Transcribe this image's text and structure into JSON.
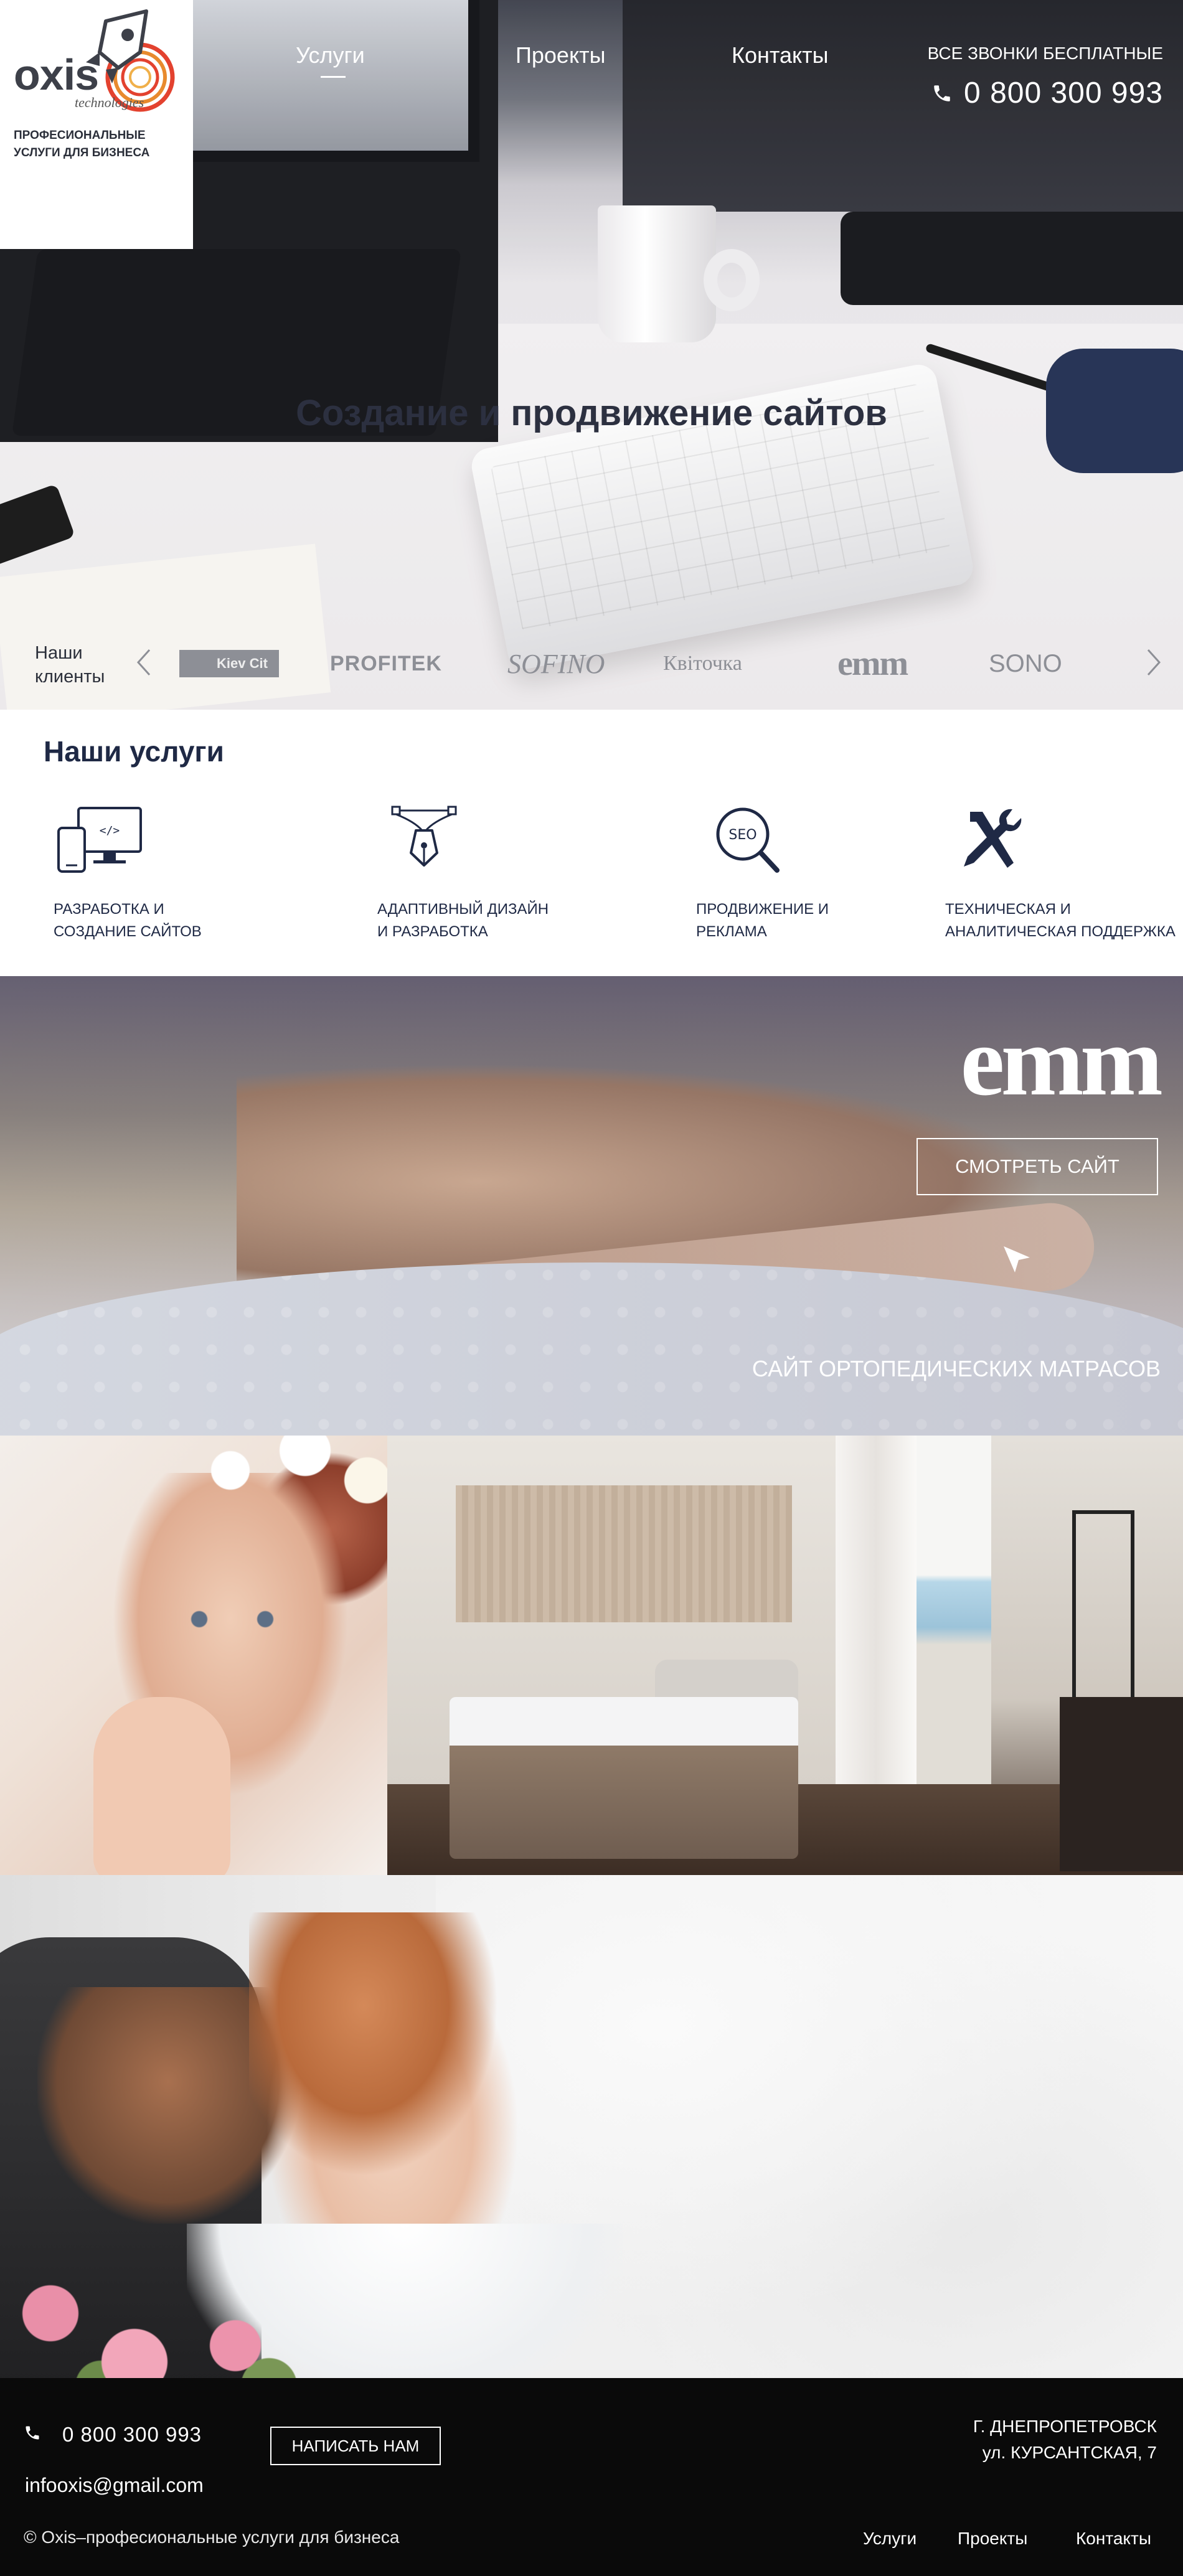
{
  "brand": {
    "logo_word": "oxis",
    "logo_sub": "technologies",
    "tagline": "ПРОФЕСИОНАЛЬНЫЕ УСЛУГИ ДЛЯ БИЗНЕСА"
  },
  "nav": {
    "items": [
      {
        "label": "Услуги",
        "active": true
      },
      {
        "label": "Проекты",
        "active": false
      },
      {
        "label": "Контакты",
        "active": false
      }
    ]
  },
  "header_contact": {
    "call_label": "ВСЕ ЗВОНКИ БЕСПЛАТНЫЕ",
    "phone": "0 800 300 993"
  },
  "hero": {
    "title": "Создание и продвижение сайтов"
  },
  "clients": {
    "label_line1": "Наши",
    "label_line2": "клиенты",
    "logos": [
      "Kiev Cit",
      "PROFITEK",
      "SOFINO",
      "Квiточка",
      "emm",
      "SONO"
    ]
  },
  "services": {
    "title": "Наши услуги",
    "items": [
      {
        "line1": "РАЗРАБОТКА И",
        "line2": "СОЗДАНИЕ САЙТОВ",
        "icon": "devices-code-icon"
      },
      {
        "line1": "АДАПТИВНЫЙ ДИЗАЙН",
        "line2": "И РАЗРАБОТКА",
        "icon": "pen-tool-icon"
      },
      {
        "line1": "ПРОДВИЖЕНИЕ И",
        "line2": "РЕКЛАМА",
        "icon": "seo-magnifier-icon"
      },
      {
        "line1": "ТЕХНИЧЕСКАЯ И",
        "line2": "АНАЛИТИЧЕСКАЯ ПОДДЕРЖКА",
        "icon": "tools-icon"
      }
    ]
  },
  "project": {
    "logo": "emm",
    "button": "СМОТРЕТЬ САЙТ",
    "caption": "САЙТ ОРТОПЕДИЧЕСКИХ МАТРАСОВ"
  },
  "footer": {
    "phone": "0 800 300 993",
    "email": "infooxis@gmail.com",
    "write_button": "НАПИСАТЬ НАМ",
    "city": "г. ДНЕПРОПЕТРОВСК",
    "street": "ул. КУРСАНТСКАЯ, 7",
    "copyright": "© Oxis–професиональные услуги для бизнеса",
    "nav": [
      "Услуги",
      "Проекты",
      "Контакты"
    ]
  },
  "colors": {
    "navy_text": "#1f2945",
    "footer_bg": "#0a0a0a",
    "white": "#ffffff"
  }
}
